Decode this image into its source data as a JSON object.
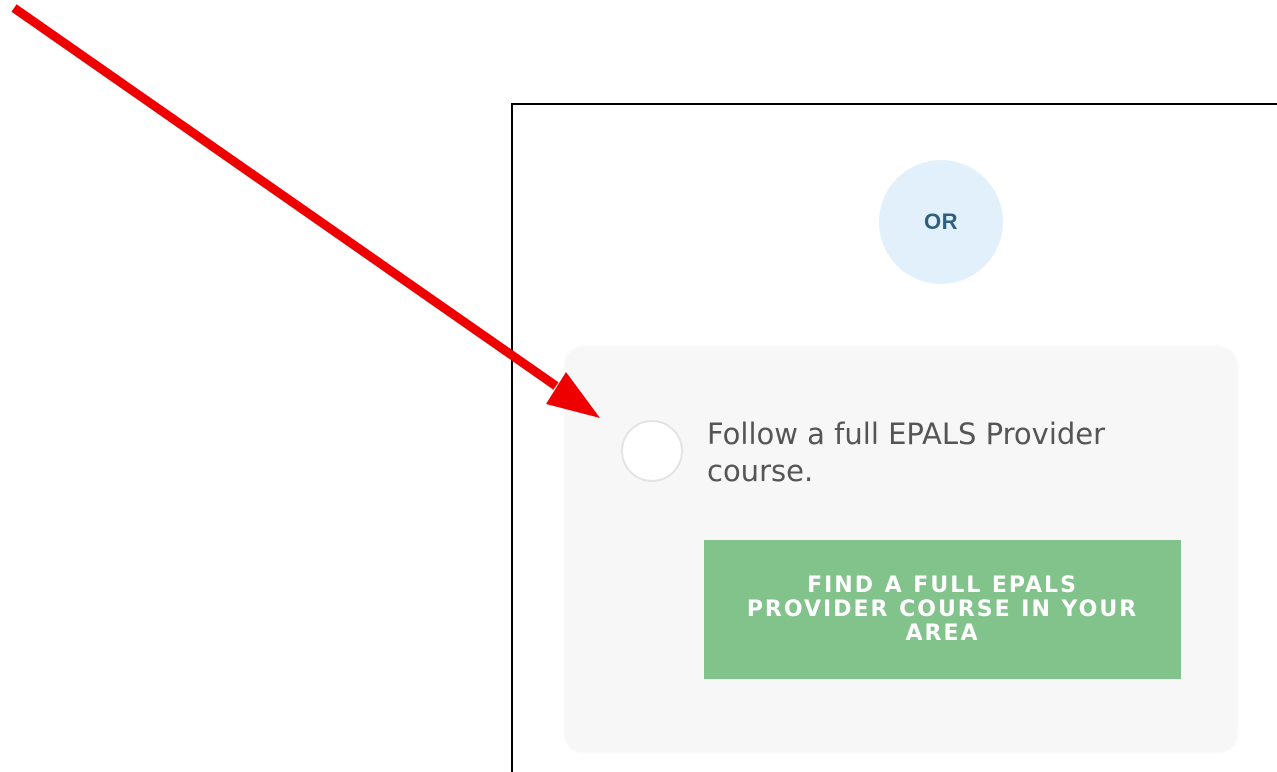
{
  "or_divider": {
    "label": "OR"
  },
  "option": {
    "label": "Follow a full EPALS Provider course.",
    "selected": false
  },
  "find_course_button": {
    "label": "FIND A FULL EPALS PROVIDER COURSE IN YOUR AREA",
    "color": "#82c38b"
  },
  "annotation": {
    "icon": "red-arrow-icon",
    "color": "#ee0000"
  }
}
